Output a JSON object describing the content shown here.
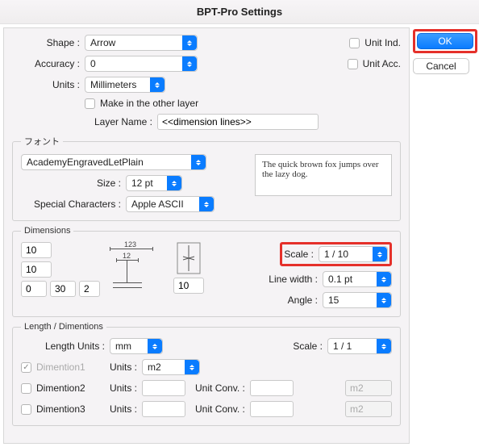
{
  "title": "BPT-Pro Settings",
  "buttons": {
    "ok": "OK",
    "cancel": "Cancel"
  },
  "top": {
    "shape_label": "Shape :",
    "shape_value": "Arrow",
    "accuracy_label": "Accuracy :",
    "accuracy_value": "0",
    "units_label": "Units :",
    "units_value": "Millimeters",
    "make_other_layer_label": "Make in the other layer",
    "layer_name_label": "Layer Name :",
    "layer_name_value": "<<dimension lines>>",
    "unit_ind": "Unit Ind.",
    "unit_acc": "Unit Acc."
  },
  "font": {
    "legend": "フォント",
    "font_value": "AcademyEngravedLetPlain",
    "size_label": "Size :",
    "size_value": "12 pt",
    "special_label": "Special Characters :",
    "special_value": "Apple ASCII",
    "preview": "The quick brown fox jumps over the lazy dog."
  },
  "dimensions": {
    "legend": "Dimensions",
    "inputs": {
      "a": "10",
      "b": "10",
      "c": "0",
      "d": "30",
      "e": "2",
      "f": "10"
    },
    "diagram_top": "123",
    "diagram_mid": "12",
    "scale_label": "Scale :",
    "scale_value": "1 / 10",
    "linewidth_label": "Line width :",
    "linewidth_value": "0.1 pt",
    "angle_label": "Angle :",
    "angle_value": "15"
  },
  "length": {
    "legend": "Length / Dimentions",
    "length_units_label": "Length Units :",
    "length_units_value": "mm",
    "scale_label": "Scale :",
    "scale_value": "1 / 1",
    "rows": [
      {
        "name": "Dimention1",
        "checked": "✓",
        "units_label": "Units :",
        "units_value": "m2",
        "conv_label": "",
        "conv_value": "",
        "right_value": ""
      },
      {
        "name": "Dimention2",
        "checked": "",
        "units_label": "Units :",
        "units_value": "",
        "conv_label": "Unit Conv. :",
        "conv_value": "",
        "right_value": "m2"
      },
      {
        "name": "Dimention3",
        "checked": "",
        "units_label": "Units :",
        "units_value": "",
        "conv_label": "Unit Conv. :",
        "conv_value": "",
        "right_value": "m2"
      }
    ]
  }
}
